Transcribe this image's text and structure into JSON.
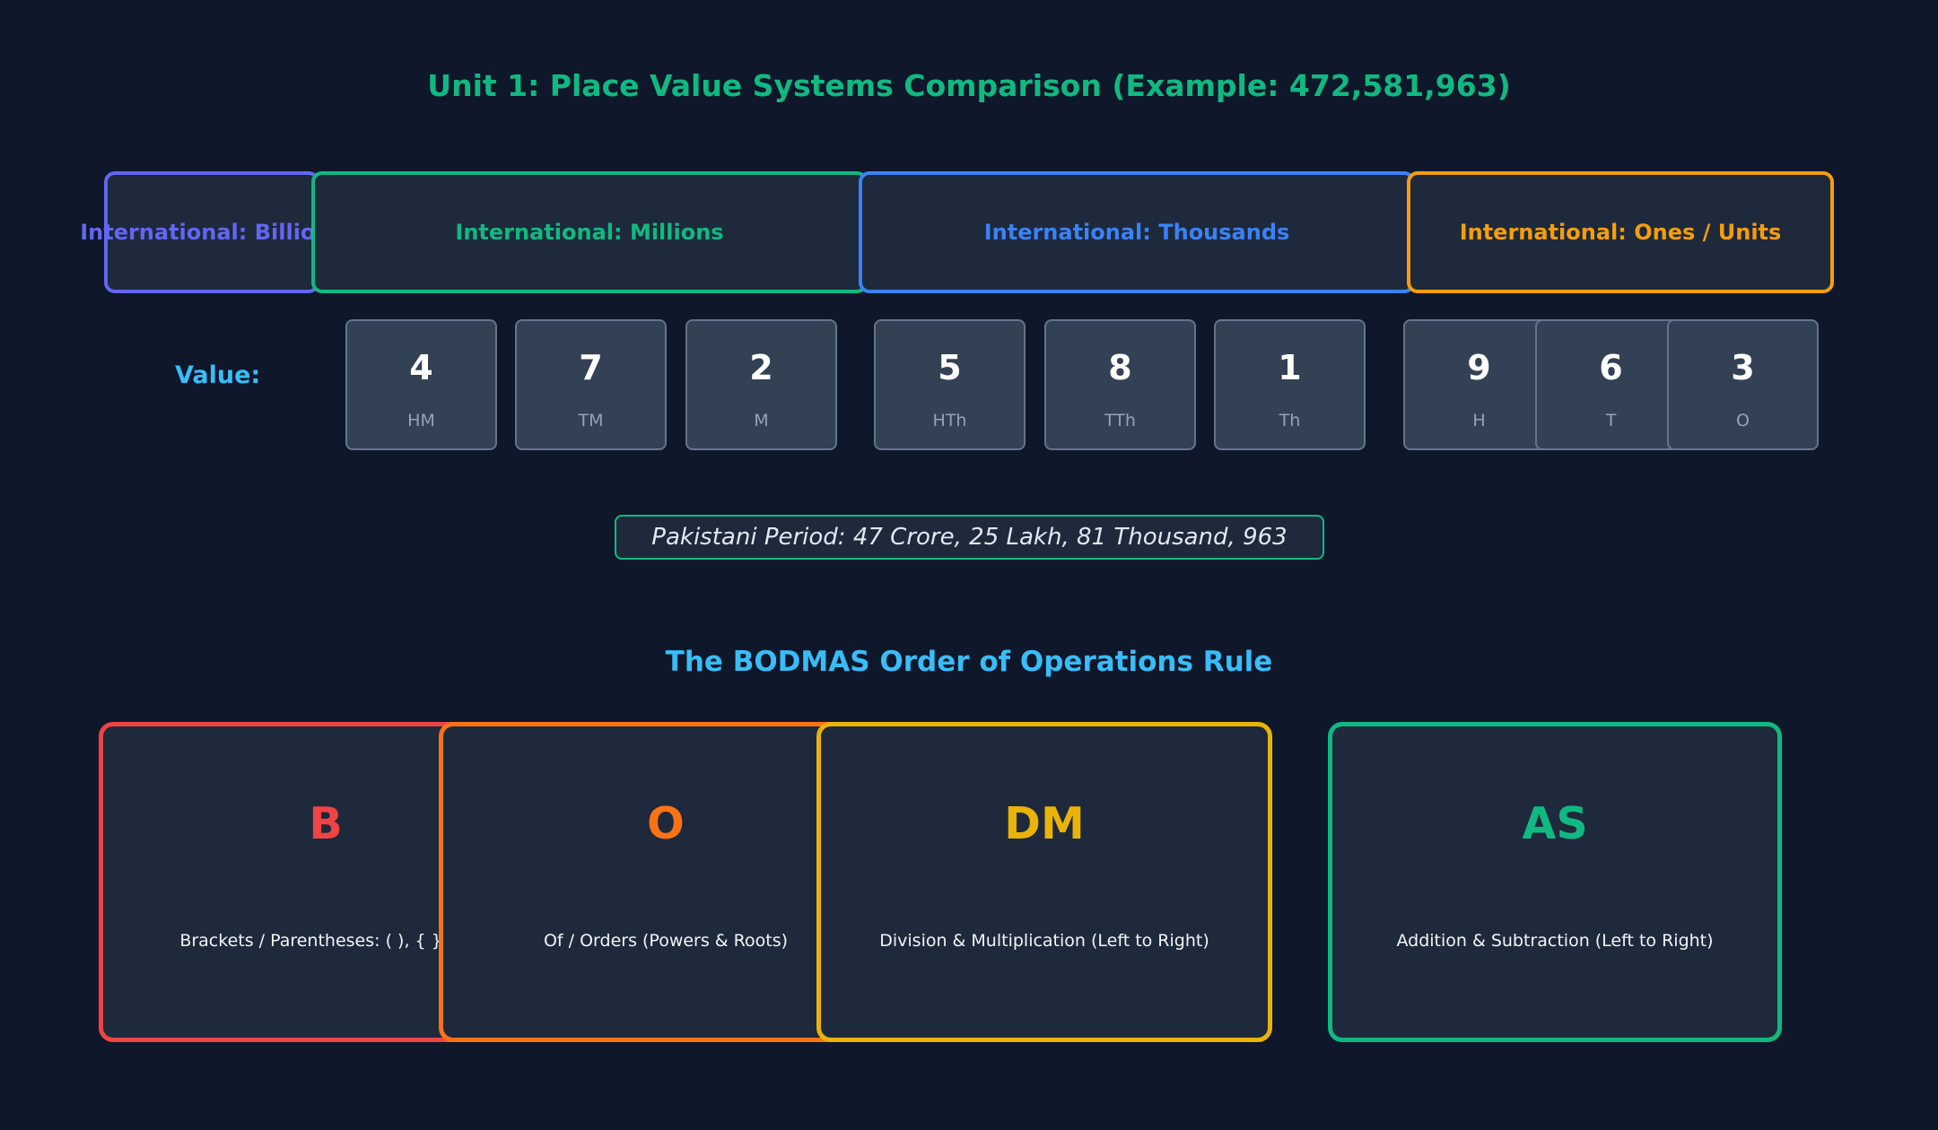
{
  "title": "Unit 1: Place Value Systems Comparison (Example: 472,581,963)",
  "periods": {
    "billions": "International: Billions",
    "millions": "International: Millions",
    "thousands": "International: Thousands",
    "ones": "International: Ones / Units"
  },
  "value_label": "Value:",
  "digits": [
    {
      "value": "4",
      "place": "HM"
    },
    {
      "value": "7",
      "place": "TM"
    },
    {
      "value": "2",
      "place": "M"
    },
    {
      "value": "5",
      "place": "HTh"
    },
    {
      "value": "8",
      "place": "TTh"
    },
    {
      "value": "1",
      "place": "Th"
    },
    {
      "value": "9",
      "place": "H"
    },
    {
      "value": "6",
      "place": "T"
    },
    {
      "value": "3",
      "place": "O"
    }
  ],
  "pakistani_period": "Pakistani Period: 47 Crore, 25 Lakh, 81 Thousand, 963",
  "bodmas_title": "The BODMAS Order of Operations Rule",
  "operations": [
    {
      "letter": "B",
      "description": "Brackets / Parentheses: ( ), { }, [ ]",
      "color": "#ef4444"
    },
    {
      "letter": "O",
      "description": "Of / Orders (Powers & Roots)",
      "color": "#f97316"
    },
    {
      "letter": "DM",
      "description": "Division & Multiplication (Left to Right)",
      "color": "#eab308"
    },
    {
      "letter": "AS",
      "description": "Addition & Subtraction (Left to Right)",
      "color": "#10b981"
    }
  ],
  "colors": {
    "background": "#0f172a",
    "panel": "#1e293b",
    "digit_box": "#334155",
    "billions": "#6366f1",
    "millions": "#10b981",
    "thousands": "#3b82f6",
    "ones": "#f59e0b",
    "accent": "#38bdf8"
  }
}
